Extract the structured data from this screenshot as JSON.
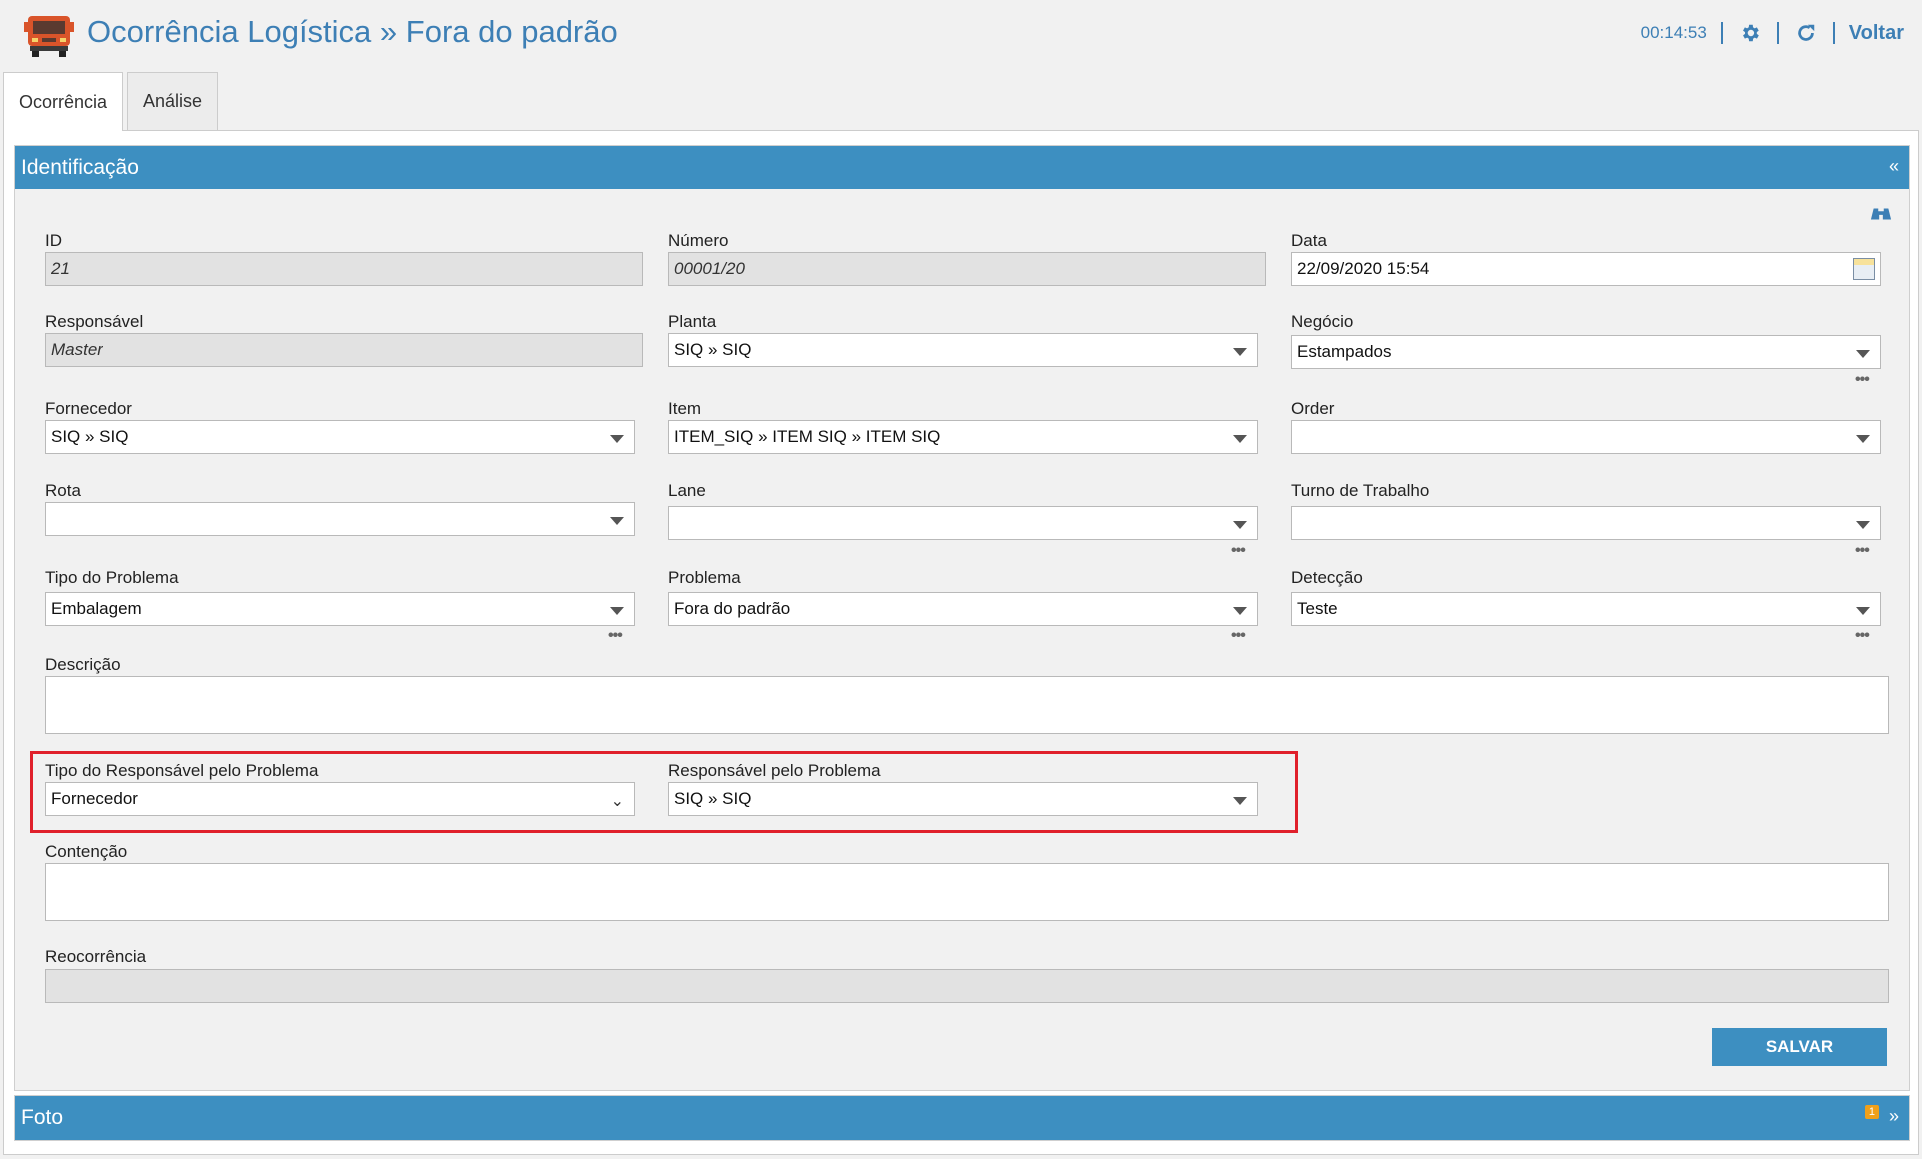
{
  "header": {
    "title": "Ocorrência Logística » Fora do padrão",
    "timer": "00:14:53",
    "voltar_label": "Voltar",
    "accent_color": "#3d7fb5"
  },
  "tabs": [
    {
      "label": "Ocorrência",
      "active": true
    },
    {
      "label": "Análise",
      "active": false
    }
  ],
  "sections": {
    "identificacao": {
      "title": "Identificação",
      "toggle": "«"
    },
    "foto": {
      "title": "Foto",
      "toggle": "»",
      "badge": "1"
    }
  },
  "form": {
    "id": {
      "label": "ID",
      "value": "21"
    },
    "numero": {
      "label": "Número",
      "value": "00001/20"
    },
    "data": {
      "label": "Data",
      "value": "22/09/2020 15:54"
    },
    "responsavel": {
      "label": "Responsável",
      "value": "Master"
    },
    "planta": {
      "label": "Planta",
      "value": "SIQ  »  SIQ"
    },
    "negocio": {
      "label": "Negócio",
      "value": "Estampados"
    },
    "fornecedor": {
      "label": "Fornecedor",
      "value": "SIQ  »  SIQ"
    },
    "item": {
      "label": "Item",
      "value": "ITEM_SIQ » ITEM SIQ » ITEM SIQ"
    },
    "order": {
      "label": "Order",
      "value": ""
    },
    "rota": {
      "label": "Rota",
      "value": ""
    },
    "lane": {
      "label": "Lane",
      "value": ""
    },
    "turno": {
      "label": "Turno de Trabalho",
      "value": ""
    },
    "tipo_problema": {
      "label": "Tipo do Problema",
      "value": "Embalagem"
    },
    "problema": {
      "label": "Problema",
      "value": "Fora do padrão"
    },
    "deteccao": {
      "label": "Detecção",
      "value": "Teste"
    },
    "descricao": {
      "label": "Descrição",
      "value": ""
    },
    "tipo_resp_problema": {
      "label": "Tipo do Responsável pelo Problema",
      "value": "Fornecedor"
    },
    "resp_problema": {
      "label": "Responsável pelo Problema",
      "value": "SIQ  »  SIQ"
    },
    "contencao": {
      "label": "Contenção",
      "value": ""
    },
    "reocorrencia": {
      "label": "Reocorrência",
      "value": ""
    }
  },
  "more_glyph": "•••",
  "save_label": "SALVAR"
}
